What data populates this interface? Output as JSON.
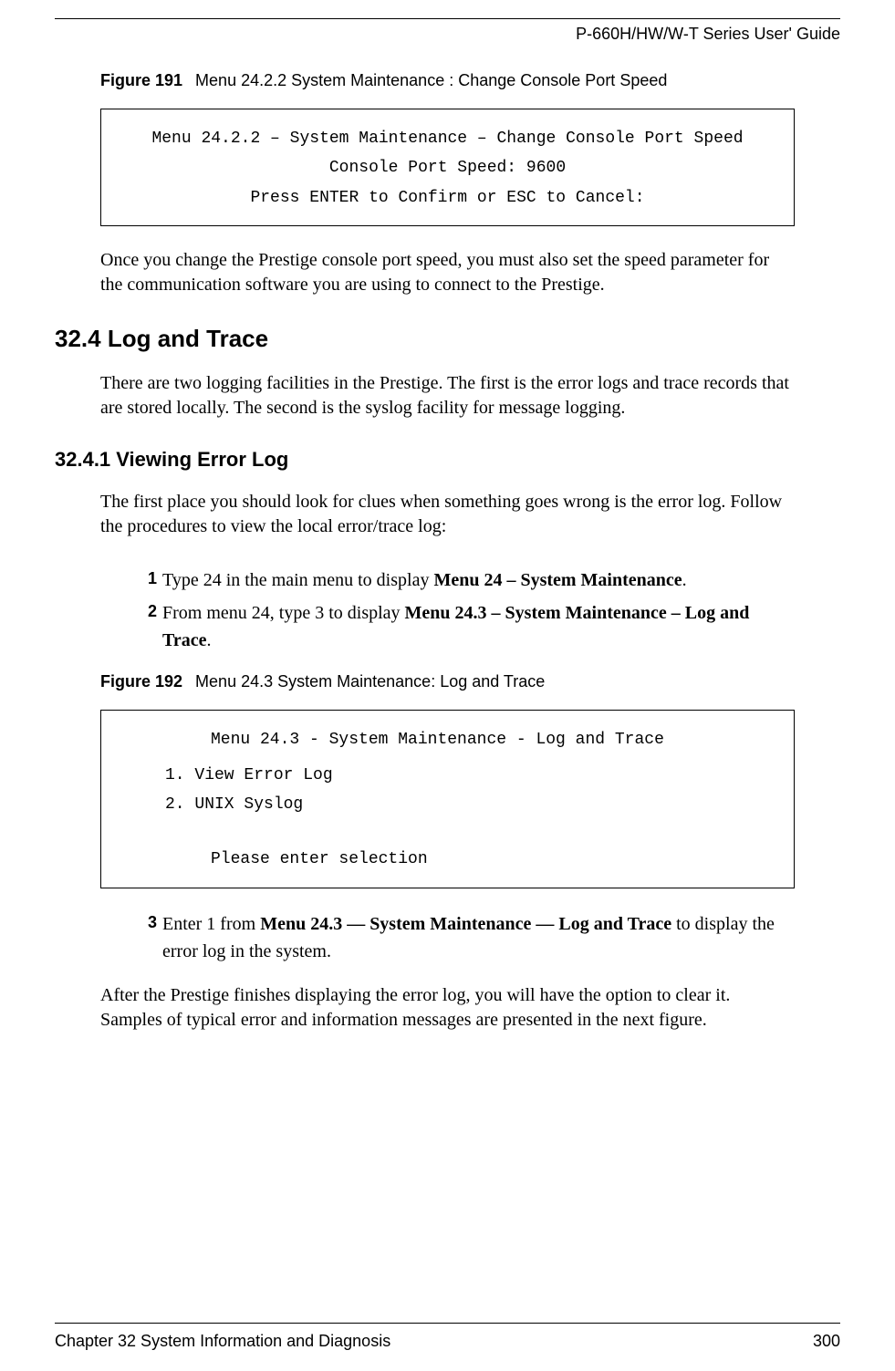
{
  "header": {
    "title": "P-660H/HW/W-T Series User' Guide"
  },
  "figure191": {
    "label": "Figure 191",
    "caption": "Menu 24.2.2 System Maintenance : Change Console Port Speed",
    "line1": "Menu 24.2.2 – System Maintenance – Change Console Port Speed",
    "line2": "Console Port Speed: 9600",
    "line3": "Press ENTER to Confirm or ESC to Cancel:"
  },
  "para1": "Once you change the Prestige console port speed, you must also set the speed parameter for the communication software you are using to connect to the Prestige.",
  "section324": {
    "heading": "32.4  Log and Trace",
    "para": "There are two logging facilities in the Prestige. The first is the error logs and trace records that are stored locally. The second is the syslog facility for message logging."
  },
  "section3241": {
    "heading": "32.4.1  Viewing Error Log",
    "para": "The first place you should look for clues when something goes wrong is the error log. Follow the procedures to view the local error/trace log:"
  },
  "steps1": {
    "s1": {
      "num": "1",
      "pre": "Type 24 in the main menu to display ",
      "bold": "Menu 24 – System Maintenance",
      "post": "."
    },
    "s2": {
      "num": "2",
      "pre": "From menu 24, type 3 to display ",
      "bold": "Menu 24.3 – System Maintenance – Log and Trace",
      "post": "."
    }
  },
  "figure192": {
    "label": "Figure 192",
    "caption": "Menu 24.3 System Maintenance: Log and Trace",
    "title": "Menu 24.3 - System Maintenance - Log and Trace",
    "opt1": "1. View Error Log",
    "opt2": "2. UNIX Syslog",
    "prompt": "Please enter selection"
  },
  "steps2": {
    "s3": {
      "num": "3",
      "pre": "Enter 1 from ",
      "bold": "Menu 24.3 — System Maintenance — Log and Trace",
      "post": " to display the error log in the system."
    }
  },
  "para_after": "After the Prestige finishes displaying the error log, you will have the option to clear it. Samples of typical error and information messages are presented in the next figure.",
  "footer": {
    "left": "Chapter 32 System Information and Diagnosis",
    "right": "300"
  }
}
